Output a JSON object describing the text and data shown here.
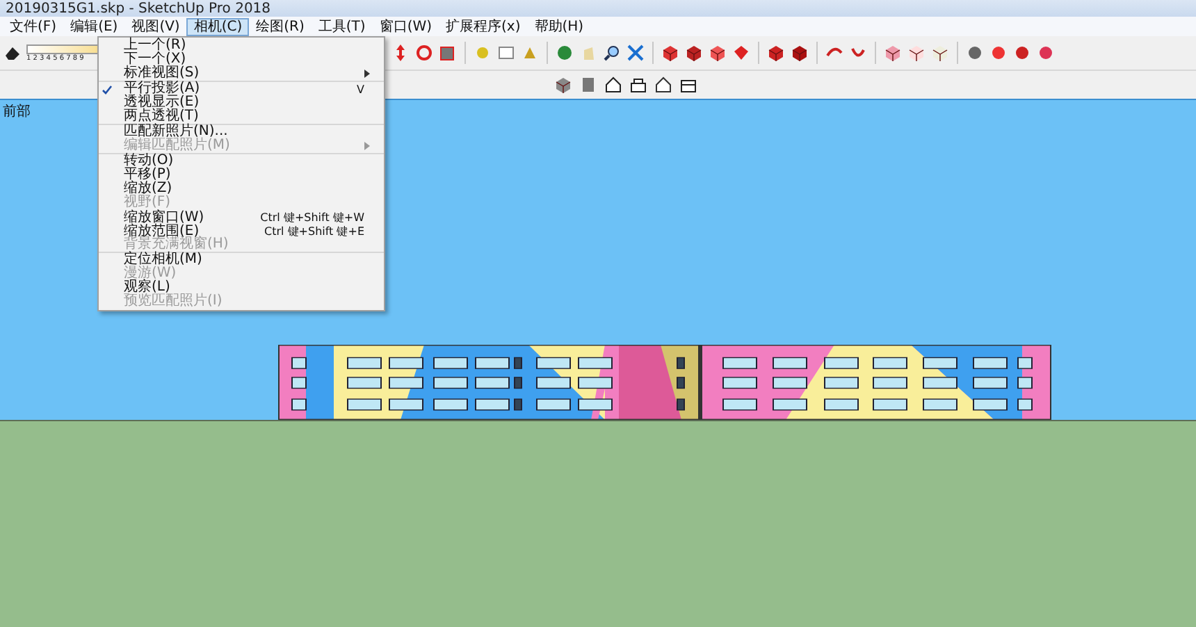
{
  "window": {
    "title": "20190315G1.skp - SketchUp Pro 2018"
  },
  "menubar": [
    {
      "label": "文件(F)",
      "selected": false
    },
    {
      "label": "编辑(E)",
      "selected": false
    },
    {
      "label": "视图(V)",
      "selected": false
    },
    {
      "label": "相机(C)",
      "selected": true
    },
    {
      "label": "绘图(R)",
      "selected": false
    },
    {
      "label": "工具(T)",
      "selected": false
    },
    {
      "label": "窗口(W)",
      "selected": false
    },
    {
      "label": "扩展程序(x)",
      "selected": false
    },
    {
      "label": "帮助(H)",
      "selected": false
    }
  ],
  "toolbar": {
    "scale_digits": "1 2 3 4 5 6 7 8 9"
  },
  "scene_tab": "前部",
  "camera_menu": {
    "groups": [
      [
        {
          "label": "上一个(R)",
          "checked": false,
          "disabled": false,
          "submenu": false
        },
        {
          "label": "下一个(X)",
          "checked": false,
          "disabled": false,
          "submenu": false
        },
        {
          "label": "标准视图(S)",
          "checked": false,
          "disabled": false,
          "submenu": true
        }
      ],
      [
        {
          "label": "平行投影(A)",
          "shortcut": "V",
          "checked": true,
          "disabled": false,
          "submenu": false
        },
        {
          "label": "透视显示(E)",
          "checked": false,
          "disabled": false,
          "submenu": false
        },
        {
          "label": "两点透视(T)",
          "checked": false,
          "disabled": false,
          "submenu": false
        }
      ],
      [
        {
          "label": "匹配新照片(N)...",
          "checked": false,
          "disabled": false,
          "submenu": false
        },
        {
          "label": "编辑匹配照片(M)",
          "checked": false,
          "disabled": true,
          "submenu": true
        }
      ],
      [
        {
          "label": "转动(O)",
          "checked": false,
          "disabled": false,
          "submenu": false
        },
        {
          "label": "平移(P)",
          "checked": false,
          "disabled": false,
          "submenu": false
        },
        {
          "label": "缩放(Z)",
          "checked": false,
          "disabled": false,
          "submenu": false
        },
        {
          "label": "视野(F)",
          "checked": false,
          "disabled": true,
          "submenu": false
        },
        {
          "label": "缩放窗口(W)",
          "shortcut": "Ctrl 键+Shift 键+W",
          "checked": false,
          "disabled": false,
          "submenu": false
        },
        {
          "label": "缩放范围(E)",
          "shortcut": "Ctrl 键+Shift 键+E",
          "checked": false,
          "disabled": false,
          "submenu": false
        },
        {
          "label": "背景充满视窗(H)",
          "checked": false,
          "disabled": true,
          "submenu": false
        }
      ],
      [
        {
          "label": "定位相机(M)",
          "checked": false,
          "disabled": false,
          "submenu": false
        },
        {
          "label": "漫游(W)",
          "checked": false,
          "disabled": true,
          "submenu": false
        },
        {
          "label": "观察(L)",
          "checked": false,
          "disabled": false,
          "submenu": false
        },
        {
          "label": "预览匹配照片(I)",
          "checked": false,
          "disabled": true,
          "submenu": false
        }
      ]
    ]
  }
}
